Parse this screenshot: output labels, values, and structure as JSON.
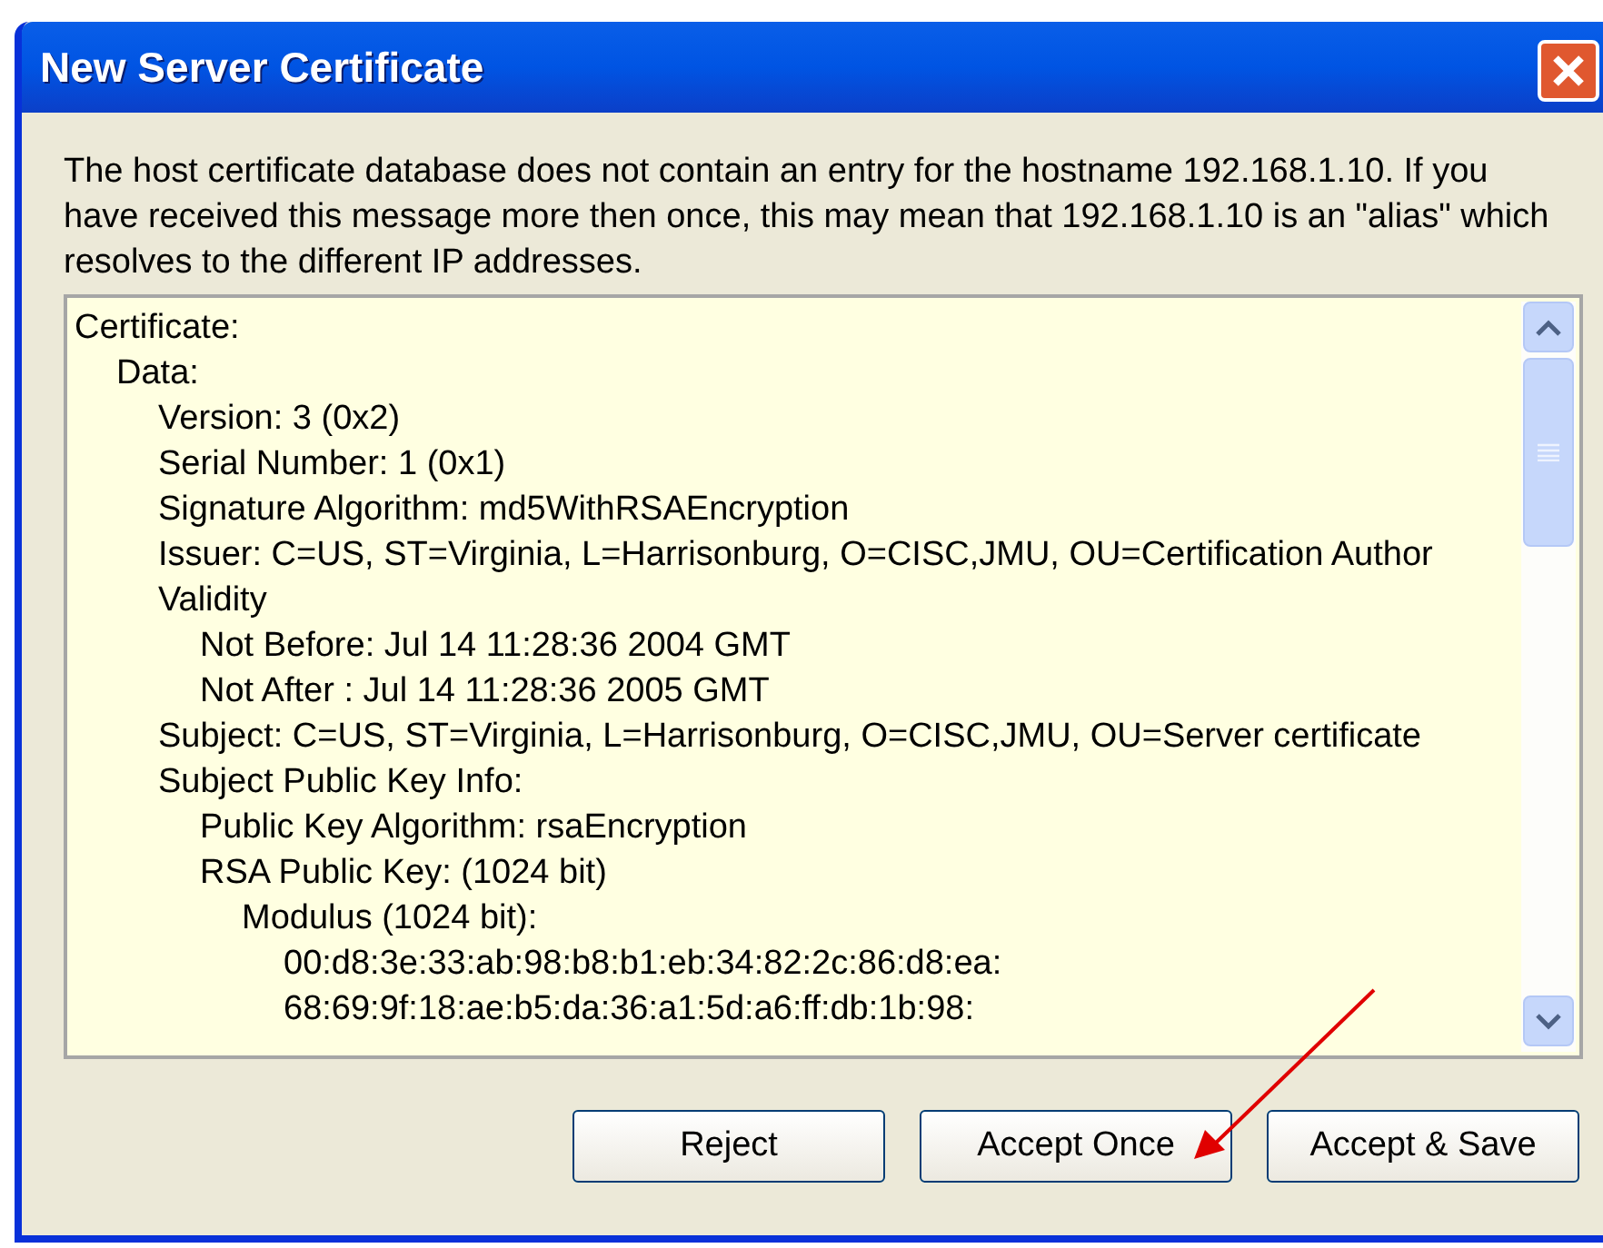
{
  "window": {
    "title": "New Server Certificate"
  },
  "message": "The host certificate database does not contain an entry for the hostname 192.168.1.10. If you have received this message more then once, this may mean that 192.168.1.10 is an \"alias\" which resolves to the different IP addresses.",
  "certificate": [
    {
      "text": "Certificate:",
      "children": [
        {
          "text": "Data:",
          "children": [
            {
              "text": "Version: 3 (0x2)"
            },
            {
              "text": "Serial Number: 1 (0x1)"
            },
            {
              "text": "Signature Algorithm: md5WithRSAEncryption"
            },
            {
              "text": "Issuer: C=US, ST=Virginia, L=Harrisonburg, O=CISC,JMU, OU=Certification Author"
            },
            {
              "text": "Validity",
              "children": [
                {
                  "text": "Not Before: Jul 14 11:28:36 2004 GMT"
                },
                {
                  "text": "Not After : Jul 14 11:28:36 2005 GMT"
                }
              ]
            },
            {
              "text": "Subject: C=US, ST=Virginia, L=Harrisonburg, O=CISC,JMU, OU=Server certificate"
            },
            {
              "text": "Subject Public Key Info:",
              "children": [
                {
                  "text": "Public Key Algorithm: rsaEncryption"
                },
                {
                  "text": "RSA Public Key: (1024 bit)",
                  "children": [
                    {
                      "text": "Modulus (1024 bit):",
                      "children": [
                        {
                          "text": "00:d8:3e:33:ab:98:b8:b1:eb:34:82:2c:86:d8:ea:"
                        },
                        {
                          "text": "68:69:9f:18:ae:b5:da:36:a1:5d:a6:ff:db:1b:98:"
                        }
                      ]
                    }
                  ]
                }
              ]
            }
          ]
        }
      ]
    }
  ],
  "buttons": [
    {
      "label": "Reject"
    },
    {
      "label": "Accept Once"
    },
    {
      "label": "Accept & Save"
    }
  ]
}
